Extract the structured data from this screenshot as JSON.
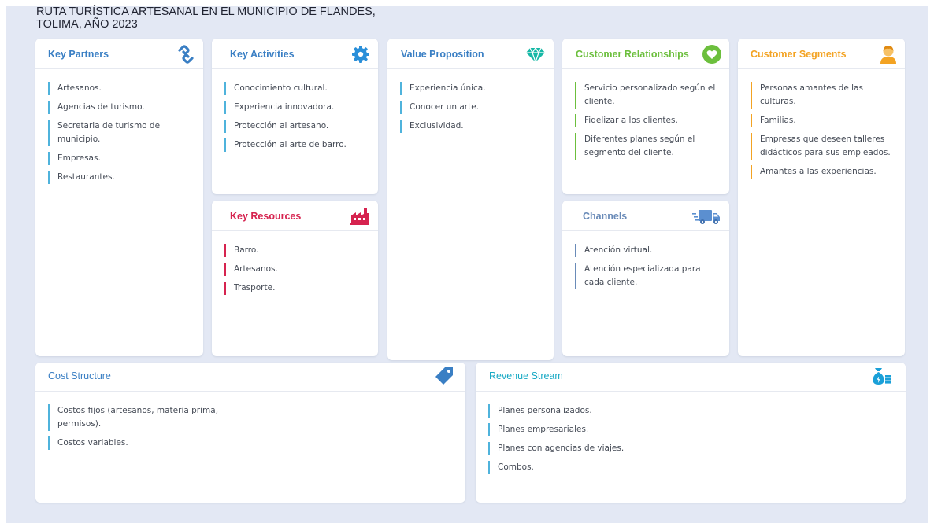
{
  "title": {
    "line1": "RUTA TURÍSTICA ARTESANAL EN EL MUNICIPIO DE FLANDES,",
    "line2": "TOLIMA, AÑO 2023"
  },
  "colors": {
    "blue": "#3a7fc4",
    "cyan": "#17a9c4",
    "red": "#d6234f",
    "green": "#6cbf3d",
    "orange": "#f3a323",
    "slate": "#6a8bb8",
    "accent_line": "#4fb3dc"
  },
  "blocks": {
    "key_partners": {
      "title": "Key Partners",
      "icon": "link-icon",
      "items": [
        "Artesanos.",
        "Agencias de turismo.",
        "Secretaria de turismo del municipio.",
        "Empresas.",
        "Restaurantes."
      ]
    },
    "key_activities": {
      "title": "Key Activities",
      "icon": "gear-icon",
      "items": [
        "Conocimiento  cultural.",
        "Experiencia innovadora.",
        "Protección  al artesano.",
        "Protección  al arte de barro."
      ]
    },
    "key_resources": {
      "title": "Key Resources",
      "icon": "factory-icon",
      "items": [
        "Barro.",
        "Artesanos.",
        "Trasporte."
      ]
    },
    "value_proposition": {
      "title": "Value Proposition",
      "icon": "diamond-icon",
      "items": [
        "Experiencia única.",
        "Conocer un arte.",
        "Exclusividad."
      ]
    },
    "customer_relationships": {
      "title": "Customer  Relationships",
      "icon": "heart-icon",
      "items": [
        "Servicio personalizado según el cliente.",
        "Fidelizar a los clientes.",
        "Diferentes planes según el segmento del cliente."
      ]
    },
    "channels": {
      "title": "Channels",
      "icon": "truck-icon",
      "items": [
        "Atención virtual.",
        "Atención especializada para cada cliente."
      ]
    },
    "customer_segments": {
      "title": "Customer Segments",
      "icon": "person-icon",
      "items": [
        "Personas amantes de las culturas.",
        "Familias.",
        "Empresas que deseen talleres didácticos  para sus empleados.",
        "Amantes a las experiencias."
      ]
    },
    "cost_structure": {
      "title": "Cost Structure",
      "icon": "price-tag-icon",
      "items": [
        "Costos fijos (artesanos, materia prima, permisos).",
        "Costos variables."
      ]
    },
    "revenue_stream": {
      "title": "Revenue  Stream",
      "icon": "money-bag-icon",
      "items": [
        "Planes personalizados.",
        "Planes empresariales.",
        "Planes con agencias de viajes.",
        "Combos."
      ]
    }
  }
}
